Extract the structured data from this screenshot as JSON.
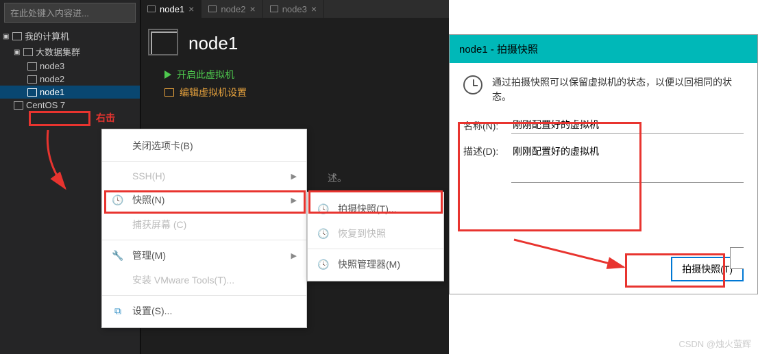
{
  "sidebar": {
    "search_placeholder": "在此处键入内容进...",
    "root": "我的计算机",
    "group": "大数据集群",
    "items": [
      "node3",
      "node2",
      "node1"
    ],
    "centos": "CentOS 7"
  },
  "tabs": {
    "t1": "node1",
    "t2": "node2",
    "t3": "node3"
  },
  "main": {
    "title": "node1",
    "start": "开启此虚拟机",
    "edit": "编辑虚拟机设置",
    "desc_fragment": "述。"
  },
  "context1": {
    "close_tab": "关闭选项卡(B)",
    "ssh": "SSH(H)",
    "snapshot": "快照(N)",
    "capture": "捕获屏幕 (C)",
    "manage": "管理(M)",
    "vmtools": "安装 VMware Tools(T)...",
    "settings": "设置(S)..."
  },
  "context2": {
    "take": "拍摄快照(T)...",
    "restore": "恢复到快照",
    "manager": "快照管理器(M)"
  },
  "dialog": {
    "title": "node1 - 拍摄快照",
    "info": "通过拍摄快照可以保留虚拟机的状态，以便以回相同的状态。",
    "name_label": "名称(N):",
    "name_value": "刚刚配置好的虚拟机",
    "desc_label": "描述(D):",
    "desc_value": "刚刚配置好的虚拟机",
    "take_btn": "拍摄快照(T)"
  },
  "annotation": {
    "right_click": "右击"
  },
  "watermark": "CSDN @烛火萤辉"
}
